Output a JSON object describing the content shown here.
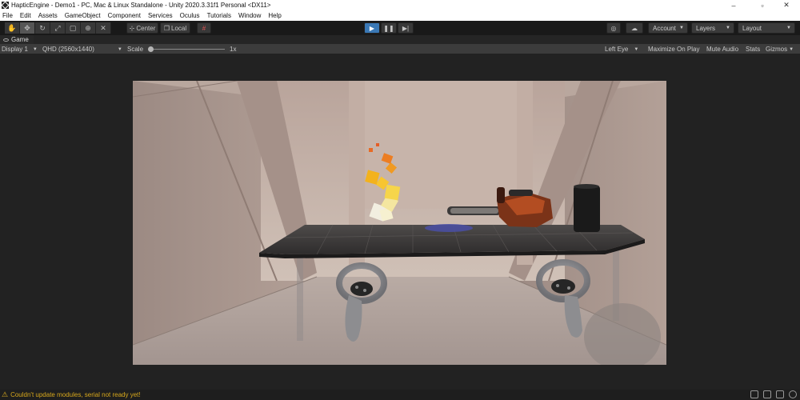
{
  "window": {
    "title": "HapticEngine - Demo1 - PC, Mac & Linux Standalone - Unity 2020.3.31f1 Personal <DX11>",
    "controls": [
      "–",
      "▫",
      "✕"
    ]
  },
  "menu": [
    "File",
    "Edit",
    "Assets",
    "GameObject",
    "Component",
    "Services",
    "Oculus",
    "Tutorials",
    "Window",
    "Help"
  ],
  "toolbar": {
    "tools": [
      "hand-tool",
      "move-tool",
      "rotate-tool",
      "scale-tool",
      "rect-tool",
      "transform-tool",
      "custom-tool"
    ],
    "pivot_label": "Center",
    "space_label": "Local",
    "account_label": "Account",
    "layers_label": "Layers",
    "layout_label": "Layout"
  },
  "tabs": {
    "game_label": "Game"
  },
  "gamebar": {
    "display": "Display 1",
    "resolution": "QHD (2560x1440)",
    "scale_label": "Scale",
    "scale_value": "1x",
    "left_eye": "Left Eye",
    "maximize": "Maximize On Play",
    "mute": "Mute Audio",
    "stats": "Stats",
    "gizmos": "Gizmos"
  },
  "status": {
    "message": "Couldn't update modules, serial not ready yet!"
  },
  "colors": {
    "accent": "#3a78b5",
    "warning": "#d8a81c"
  }
}
